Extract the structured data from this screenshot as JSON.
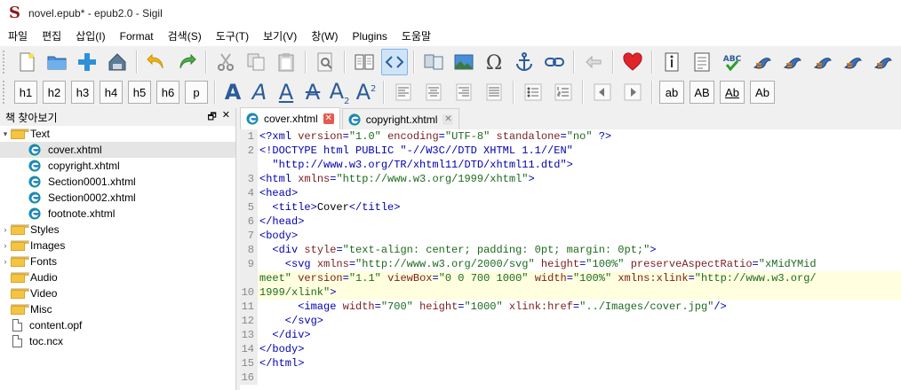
{
  "window": {
    "title": "novel.epub* - epub2.0 - Sigil",
    "logo_letter": "S"
  },
  "menu": [
    "파일",
    "편집",
    "삽입(I)",
    "Format",
    "검색(S)",
    "도구(T)",
    "보기(V)",
    "창(W)",
    "Plugins",
    "도움말"
  ],
  "toolbar1": {
    "group1": [
      "new-file-icon",
      "open-folder-icon",
      "add-file-icon",
      "save-icon"
    ],
    "group2": [
      "undo-icon",
      "redo-icon"
    ],
    "group3": [
      "cut-icon",
      "copy-icon",
      "paste-icon"
    ],
    "group4": [
      "preview-icon"
    ],
    "group5": [
      "book-view-icon",
      "code-view-icon"
    ],
    "group6": [
      "split-icon",
      "insert-image-icon",
      "omega-icon",
      "anchor-icon",
      "link-icon"
    ],
    "group7": [
      "back-arrow-icon"
    ],
    "group8": [
      "heart-icon"
    ],
    "group9": [
      "metadata-icon",
      "toc-icon",
      "spellcheck-icon",
      "plugin-1-icon",
      "plugin-2-icon",
      "plugin-3-icon",
      "plugin-4-icon",
      "plugin-5-icon"
    ]
  },
  "toolbar2": {
    "headings": [
      "h1",
      "h2",
      "h3",
      "h4",
      "h5",
      "h6",
      "p"
    ],
    "text_styles": [
      "A",
      "A",
      "A",
      "A",
      "A",
      "A"
    ],
    "sub_label": "2",
    "sup_label": "2",
    "case_buttons": [
      "ab",
      "AB",
      "Ab",
      "Ab"
    ]
  },
  "panel": {
    "title": "책 찾아보기",
    "float_glyph": "🗗",
    "close_glyph": "✕"
  },
  "tree": [
    {
      "type": "folder",
      "label": "Text",
      "expanded": true,
      "level": 0
    },
    {
      "type": "xhtml",
      "label": "cover.xhtml",
      "level": 1,
      "selected": true
    },
    {
      "type": "xhtml",
      "label": "copyright.xhtml",
      "level": 1
    },
    {
      "type": "xhtml",
      "label": "Section0001.xhtml",
      "level": 1
    },
    {
      "type": "xhtml",
      "label": "Section0002.xhtml",
      "level": 1
    },
    {
      "type": "xhtml",
      "label": "footnote.xhtml",
      "level": 1
    },
    {
      "type": "folder",
      "label": "Styles",
      "expanded": false,
      "level": 0
    },
    {
      "type": "folder",
      "label": "Images",
      "expanded": false,
      "level": 0
    },
    {
      "type": "folder",
      "label": "Fonts",
      "expanded": false,
      "level": 0
    },
    {
      "type": "folder",
      "label": "Audio",
      "expanded": null,
      "level": 0
    },
    {
      "type": "folder",
      "label": "Video",
      "expanded": null,
      "level": 0
    },
    {
      "type": "folder",
      "label": "Misc",
      "expanded": null,
      "level": 0
    },
    {
      "type": "file",
      "label": "content.opf",
      "level": 0
    },
    {
      "type": "file",
      "label": "toc.ncx",
      "level": 0
    }
  ],
  "tabs": [
    {
      "label": "cover.xhtml",
      "active": true
    },
    {
      "label": "copyright.xhtml",
      "active": false
    }
  ],
  "code_lines": [
    {
      "num": "1",
      "parts": [
        [
          "pi",
          "<?xml "
        ],
        [
          "attr",
          "version"
        ],
        [
          "pi",
          "="
        ],
        [
          "val",
          "\"1.0\""
        ],
        [
          "pi",
          " "
        ],
        [
          "attr",
          "encoding"
        ],
        [
          "pi",
          "="
        ],
        [
          "val",
          "\"UTF-8\""
        ],
        [
          "pi",
          " "
        ],
        [
          "attr",
          "standalone"
        ],
        [
          "pi",
          "="
        ],
        [
          "val",
          "\"no\""
        ],
        [
          "pi",
          " ?>"
        ]
      ]
    },
    {
      "num": "2",
      "parts": [
        [
          "tag",
          "<!DOCTYPE html PUBLIC \"-//W3C//DTD XHTML 1.1//EN\""
        ]
      ]
    },
    {
      "num": "",
      "parts": [
        [
          "tag",
          "  \"http://www.w3.org/TR/xhtml11/DTD/xhtml11.dtd\">"
        ]
      ]
    },
    {
      "num": "3",
      "parts": [
        [
          "tag",
          "<html "
        ],
        [
          "attr",
          "xmlns"
        ],
        [
          "tag",
          "="
        ],
        [
          "val",
          "\"http://www.w3.org/1999/xhtml\""
        ],
        [
          "tag",
          ">"
        ]
      ]
    },
    {
      "num": "4",
      "parts": [
        [
          "tag",
          "<head>"
        ]
      ]
    },
    {
      "num": "5",
      "parts": [
        [
          "tag",
          "  <title>"
        ],
        [
          "plain",
          "Cover"
        ],
        [
          "tag",
          "</title>"
        ]
      ]
    },
    {
      "num": "6",
      "parts": [
        [
          "tag",
          "</head>"
        ]
      ]
    },
    {
      "num": "7",
      "parts": [
        [
          "tag",
          "<body>"
        ]
      ]
    },
    {
      "num": "8",
      "parts": [
        [
          "tag",
          "  <div "
        ],
        [
          "attr",
          "style"
        ],
        [
          "tag",
          "="
        ],
        [
          "val",
          "\"text-align: center; padding: 0pt; margin: 0pt;\""
        ],
        [
          "tag",
          ">"
        ]
      ]
    },
    {
      "num": "9",
      "parts": [
        [
          "tag",
          "    <svg "
        ],
        [
          "attr",
          "xmlns"
        ],
        [
          "tag",
          "="
        ],
        [
          "val",
          "\"http://www.w3.org/2000/svg\""
        ],
        [
          "tag",
          " "
        ],
        [
          "attr",
          "height"
        ],
        [
          "tag",
          "="
        ],
        [
          "val",
          "\"100%\""
        ],
        [
          "tag",
          " "
        ],
        [
          "attr",
          "preserveAspectRatio"
        ],
        [
          "tag",
          "="
        ],
        [
          "val",
          "\"xMidYMid"
        ]
      ]
    },
    {
      "num": "",
      "parts": [
        [
          "val",
          "meet\""
        ],
        [
          "tag",
          " "
        ],
        [
          "attr",
          "version"
        ],
        [
          "tag",
          "="
        ],
        [
          "val",
          "\"1.1\""
        ],
        [
          "tag",
          " "
        ],
        [
          "attr",
          "viewBox"
        ],
        [
          "tag",
          "="
        ],
        [
          "val",
          "\"0 0 700 1000\""
        ],
        [
          "tag",
          " "
        ],
        [
          "attr",
          "width"
        ],
        [
          "tag",
          "="
        ],
        [
          "val",
          "\"100%\""
        ],
        [
          "tag",
          " "
        ],
        [
          "attr",
          "xmlns:xlink"
        ],
        [
          "tag",
          "="
        ],
        [
          "val",
          "\"http://www.w3.org/"
        ]
      ],
      "highlight": true
    },
    {
      "num": "10",
      "parts": [
        [
          "val",
          "1999/xlink\""
        ],
        [
          "tag",
          ">"
        ]
      ],
      "highlight": true
    },
    {
      "num": "11",
      "parts": [
        [
          "tag",
          "      <image "
        ],
        [
          "attr",
          "width"
        ],
        [
          "tag",
          "="
        ],
        [
          "val",
          "\"700\""
        ],
        [
          "tag",
          " "
        ],
        [
          "attr",
          "height"
        ],
        [
          "tag",
          "="
        ],
        [
          "val",
          "\"1000\""
        ],
        [
          "tag",
          " "
        ],
        [
          "attr",
          "xlink:href"
        ],
        [
          "tag",
          "="
        ],
        [
          "val",
          "\"../Images/cover.jpg\""
        ],
        [
          "tag",
          "/>"
        ]
      ]
    },
    {
      "num": "12",
      "parts": [
        [
          "tag",
          "    </svg>"
        ]
      ]
    },
    {
      "num": "13",
      "parts": [
        [
          "tag",
          "  </div>"
        ]
      ]
    },
    {
      "num": "14",
      "parts": [
        [
          "tag",
          "</body>"
        ]
      ]
    },
    {
      "num": "15",
      "parts": [
        [
          "tag",
          "</html>"
        ]
      ]
    },
    {
      "num": "16",
      "parts": [
        [
          "plain",
          ""
        ]
      ]
    }
  ],
  "colors": {
    "tag": "#0000b0",
    "attr": "#7a1d1d",
    "val": "#1c6a1c",
    "highlight": "#ffffe0",
    "selected_row": "#e5e5e5"
  }
}
